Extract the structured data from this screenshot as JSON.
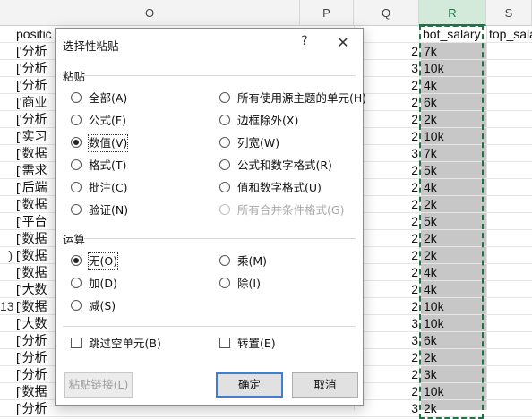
{
  "sheet": {
    "columns": [
      "O",
      "P",
      "Q",
      "R",
      "S"
    ],
    "cells": {
      "o_header": "positic",
      "r_header": "bot_salary",
      "s_header": "top_sala"
    },
    "row_prefixes": [
      "['分析",
      "['分析",
      "['分析",
      "['商业",
      "['分析",
      "['实习",
      "['数据",
      "['需求",
      "['后端",
      "['数据",
      "['平台",
      "['数据",
      "['数据",
      "['数据",
      "['大数",
      "['数据",
      "['大数",
      "['分析",
      "['分析",
      "['分析",
      "['数据",
      "['分析"
    ],
    "q_values": [
      "2",
      "3",
      "2",
      "2",
      "2",
      "2",
      "3",
      "2",
      "2",
      "2",
      "2",
      "2",
      "2",
      "2",
      "2",
      "2",
      "3",
      "3",
      "2",
      "2",
      "2",
      "3",
      "2"
    ],
    "r_values": [
      "7k",
      "10k",
      "4k",
      "6k",
      "2k",
      "10k",
      "7k",
      "5k",
      "4k",
      "2k",
      "5k",
      "2k",
      "2k",
      "4k",
      "4k",
      "10k",
      "10k",
      "6k",
      "2k",
      "3k",
      "10k",
      "2k"
    ],
    "row_numbers_visible": {
      "12": ")",
      "15": "13"
    }
  },
  "dialog": {
    "title": "选择性粘贴",
    "help": "?",
    "close": "✕",
    "paste_section": "粘贴",
    "paste_left": [
      "全部(A)",
      "公式(F)",
      "数值(V)",
      "格式(T)",
      "批注(C)",
      "验证(N)"
    ],
    "paste_right": [
      "所有使用源主题的单元(H)",
      "边框除外(X)",
      "列宽(W)",
      "公式和数字格式(R)",
      "值和数字格式(U)",
      "所有合并条件格式(G)"
    ],
    "paste_selected": "数值(V)",
    "operation_section": "运算",
    "op_left": [
      "无(O)",
      "加(D)",
      "减(S)"
    ],
    "op_right": [
      "乘(M)",
      "除(I)"
    ],
    "op_selected": "无(O)",
    "skip_blanks": "跳过空单元(B)",
    "transpose": "转置(E)",
    "paste_link": "粘贴链接(L)",
    "ok": "确定",
    "cancel": "取消"
  }
}
